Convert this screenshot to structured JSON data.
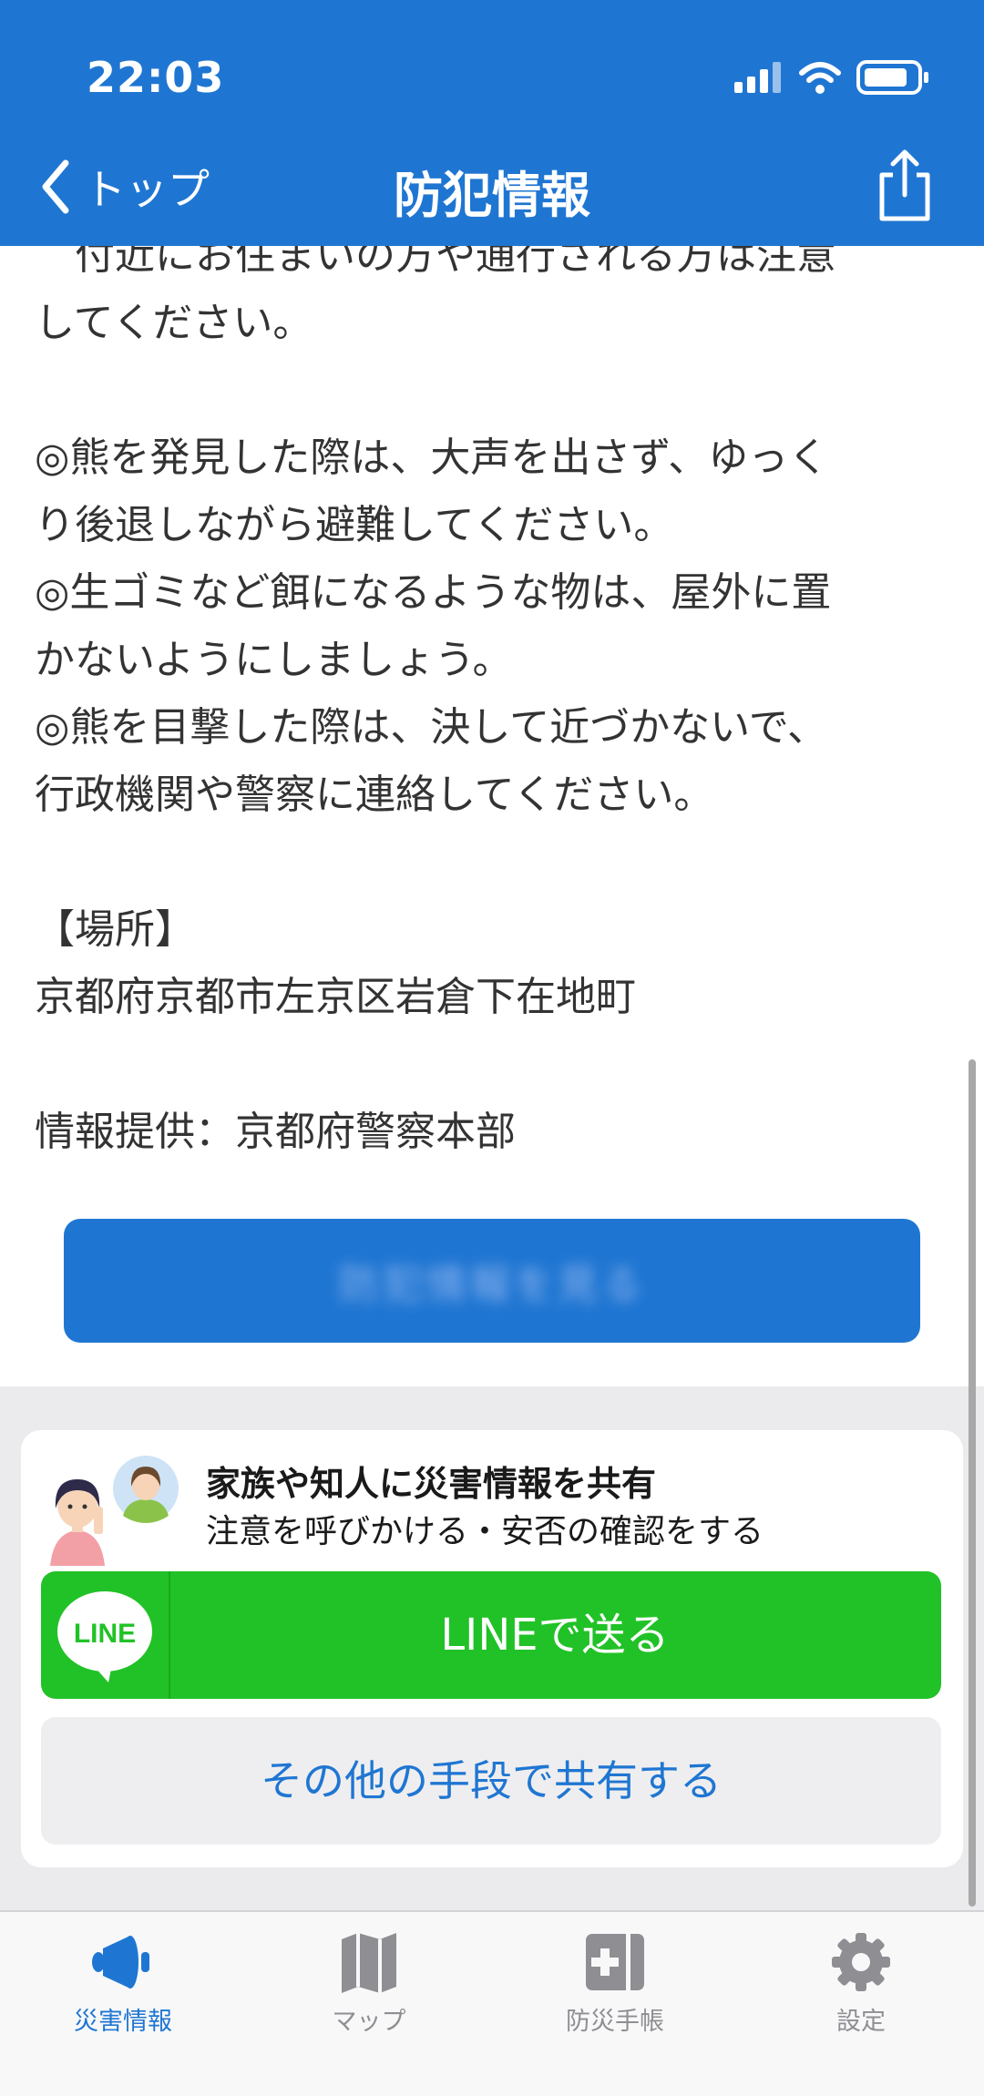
{
  "status_bar": {
    "time": "22:03"
  },
  "nav": {
    "back_label": "トップ",
    "title": "防犯情報"
  },
  "article": {
    "text": "　付近にお住まいの方や通行される方は注意\nしてください。\n\n◎熊を発見した際は、大声を出さず、ゆっく\nり後退しながら避難してください。\n◎生ゴミなど餌になるような物は、屋外に置\nかないようにしましょう。\n◎熊を目撃した際は、決して近づかないで、\n行政機関や警察に連絡してください。\n\n【場所】\n京都府京都市左京区岩倉下在地町\n\n情報提供：京都府警察本部"
  },
  "action_button": {
    "label": "防犯情報を見る"
  },
  "share": {
    "title": "家族や知人に災害情報を共有",
    "subtitle": "注意を呼びかける・安否の確認をする",
    "line_logo_text": "LINE",
    "line_button": "LINEで送る",
    "other_button": "その他の手段で共有する"
  },
  "tabs": [
    {
      "label": "災害情報",
      "icon": "megaphone-icon",
      "active": true
    },
    {
      "label": "マップ",
      "icon": "map-icon",
      "active": false
    },
    {
      "label": "防災手帳",
      "icon": "handbook-icon",
      "active": false
    },
    {
      "label": "設定",
      "icon": "gear-icon",
      "active": false
    }
  ],
  "colors": {
    "accent": "#1f76d2",
    "line_green": "#21c227",
    "inactive": "#8e8e93"
  }
}
